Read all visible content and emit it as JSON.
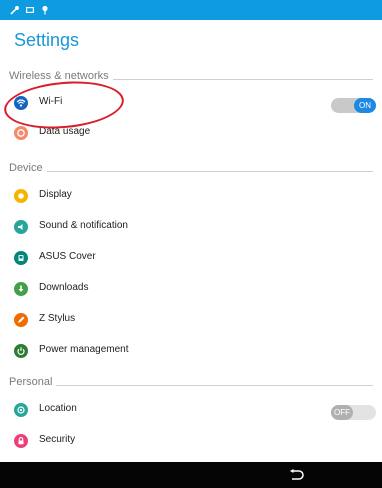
{
  "title": "Settings",
  "sections": {
    "wireless": "Wireless & networks",
    "device": "Device",
    "personal": "Personal"
  },
  "rows": {
    "wifi": {
      "label": "Wi-Fi",
      "toggle": "ON",
      "icon": "wifi-icon",
      "color": "#1565c0"
    },
    "data": {
      "label": "Data usage",
      "icon": "data-usage-icon",
      "color": "#f4896b"
    },
    "display": {
      "label": "Display",
      "icon": "display-icon",
      "color": "#f4b400"
    },
    "sound": {
      "label": "Sound & notification",
      "icon": "sound-icon",
      "color": "#26a69a"
    },
    "cover": {
      "label": "ASUS Cover",
      "icon": "cover-icon",
      "color": "#00897b"
    },
    "downloads": {
      "label": "Downloads",
      "icon": "downloads-icon",
      "color": "#43a047"
    },
    "stylus": {
      "label": "Z Stylus",
      "icon": "stylus-icon",
      "color": "#ef6c00"
    },
    "power": {
      "label": "Power management",
      "icon": "power-icon",
      "color": "#2e7d32"
    },
    "location": {
      "label": "Location",
      "toggle": "OFF",
      "icon": "location-icon",
      "color": "#26a69a"
    },
    "security": {
      "label": "Security",
      "icon": "lock-icon",
      "color": "#ec407a"
    }
  },
  "colors": {
    "accent": "#1997d8",
    "statusbar": "#0e9be0",
    "toggle_on": "#1e88e5",
    "toggle_off": "#b0b0b0",
    "annotation": "#d91e2b"
  }
}
